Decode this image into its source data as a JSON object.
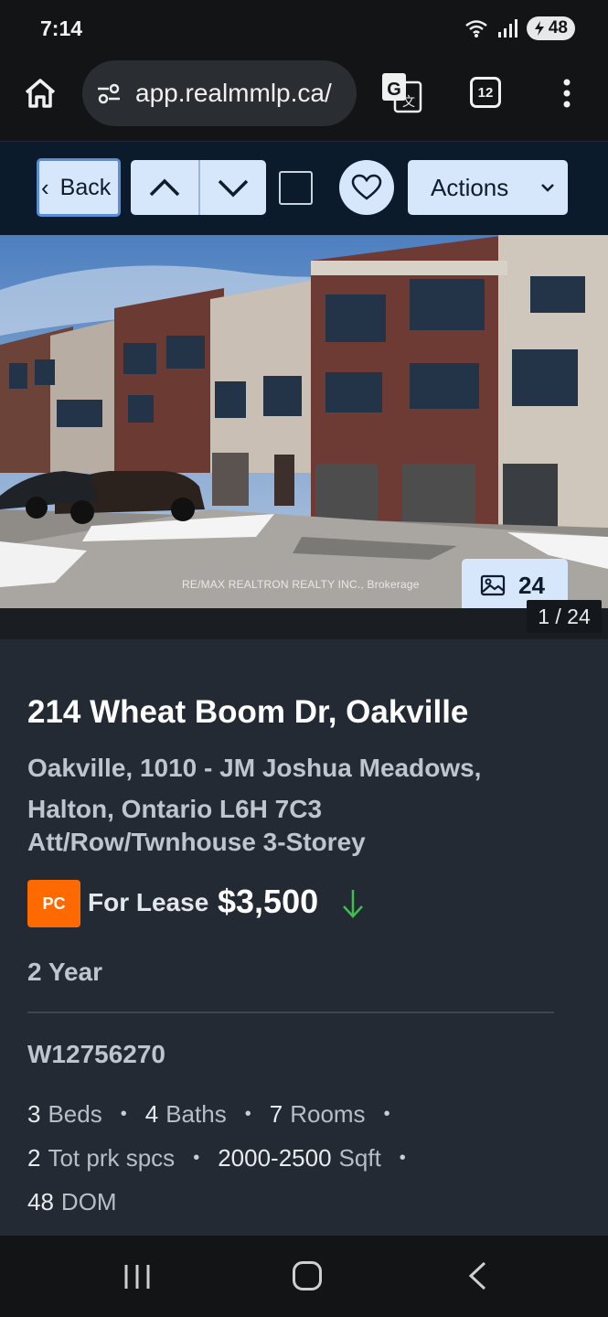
{
  "status_bar": {
    "time": "7:14",
    "battery": "48",
    "icons": [
      "wifi-icon",
      "signal-icon",
      "battery-icon"
    ]
  },
  "browser": {
    "url": "app.realmmlp.ca/",
    "tab_count": "12",
    "icons": [
      "home-icon",
      "site-settings-icon",
      "translate-icon",
      "more-vert-icon"
    ]
  },
  "app_bar": {
    "back_label": "Back",
    "actions_label": "Actions",
    "icons": [
      "chevron-left-icon",
      "chevron-up-icon",
      "chevron-down-icon",
      "checkbox-icon",
      "heart-icon"
    ]
  },
  "photo": {
    "watermark": "RE/MAX REALTRON REALTY INC., Brokerage",
    "count": "24",
    "index": "1 / 24"
  },
  "listing": {
    "address": "214 Wheat Boom Dr, Oakville",
    "community": "Oakville, 1010 - JM Joshua Meadows, Halton, Ontario L6H 7C3",
    "property_type": "Att/Row/Twnhouse 3-Storey",
    "badge": "PC",
    "status": "For Lease",
    "price": "$3,500",
    "price_trend": "down",
    "term": "2 Year",
    "mls": "W12756270",
    "specs": {
      "beds_num": "3",
      "beds_label": "Beds",
      "baths_num": "4",
      "baths_label": "Baths",
      "rooms_num": "7",
      "rooms_label": "Rooms",
      "parking_num": "2",
      "parking_label": "Tot prk spcs",
      "sqft_num": "2000-2500",
      "sqft_label": "Sqft",
      "dom_num": "48",
      "dom_label": "DOM"
    }
  },
  "colors": {
    "accent_light": "#d6e6fb",
    "app_bar": "#0c1b2c",
    "badge": "#ff6a00",
    "price_down": "#3fbf4f"
  }
}
